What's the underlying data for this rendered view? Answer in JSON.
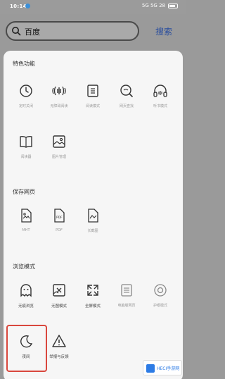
{
  "status_bar": {
    "time": "10:14",
    "right": "5G 5G 28"
  },
  "search": {
    "query": "百度",
    "button": "搜索"
  },
  "sections": {
    "special": {
      "title": "特色功能"
    },
    "save": {
      "title": "保存网页"
    },
    "browse": {
      "title": "浏览模式"
    }
  },
  "special_items": [
    {
      "label": "定时关闭",
      "icon": "clock-icon"
    },
    {
      "label": "无障碍阅读",
      "icon": "audio-wave-icon"
    },
    {
      "label": "阅读模式",
      "icon": "reading-page-icon"
    },
    {
      "label": "网页查找",
      "icon": "search-page-icon"
    },
    {
      "label": "听书模式",
      "icon": "headphones-icon"
    },
    {
      "label": "阅读器",
      "icon": "book-icon"
    },
    {
      "label": "图片管理",
      "icon": "image-icon"
    }
  ],
  "save_items": [
    {
      "label": "MHT",
      "icon": "file-image-icon"
    },
    {
      "label": "PDF",
      "icon": "pdf-file-icon"
    },
    {
      "label": "长截图",
      "icon": "long-screenshot-icon"
    }
  ],
  "browse_items": [
    {
      "label": "无痕浏览",
      "icon": "ghost-icon"
    },
    {
      "label": "无图模式",
      "icon": "no-image-icon"
    },
    {
      "label": "全屏模式",
      "icon": "fullscreen-icon"
    },
    {
      "label": "电脑版网页",
      "icon": "desktop-page-icon"
    },
    {
      "label": "护眼模式",
      "icon": "eye-icon"
    },
    {
      "label": "夜间",
      "icon": "moon-icon"
    },
    {
      "label": "举报与反馈",
      "icon": "warning-icon"
    }
  ],
  "watermark": {
    "text": "HECI手游网"
  }
}
